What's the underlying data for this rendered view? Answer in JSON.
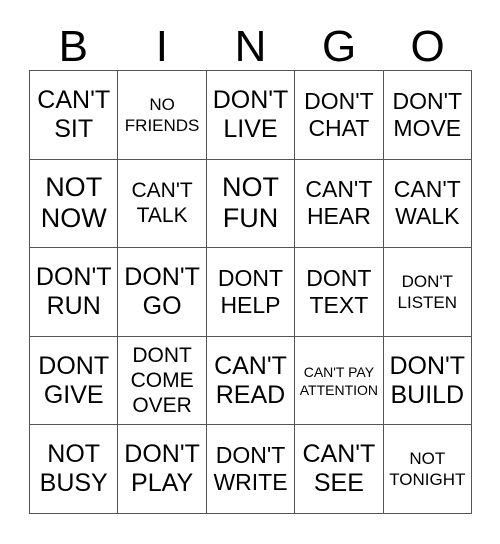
{
  "card": {
    "title_letters": [
      "B",
      "I",
      "N",
      "G",
      "O"
    ],
    "columns": 5,
    "rows": 5,
    "text_color": "#000000",
    "background_color": "#ffffff",
    "grid_line_color": "#555555"
  },
  "cells": [
    {
      "text": "CAN'T\nSIT",
      "size": "fs-lg"
    },
    {
      "text": "NO\nFRIENDS",
      "size": "fs-xs"
    },
    {
      "text": "DON'T\nLIVE",
      "size": "fs-lg"
    },
    {
      "text": "DON'T\nCHAT",
      "size": "fs-md"
    },
    {
      "text": "DON'T\nMOVE",
      "size": "fs-md"
    },
    {
      "text": "NOT\nNOW",
      "size": "fs-xl"
    },
    {
      "text": "CAN'T\nTALK",
      "size": "fs-sm"
    },
    {
      "text": "NOT\nFUN",
      "size": "fs-xl"
    },
    {
      "text": "CAN'T\nHEAR",
      "size": "fs-md"
    },
    {
      "text": "CAN'T\nWALK",
      "size": "fs-md"
    },
    {
      "text": "DON'T\nRUN",
      "size": "fs-lg"
    },
    {
      "text": "DON'T\nGO",
      "size": "fs-lg"
    },
    {
      "text": "DONT\nHELP",
      "size": "fs-md"
    },
    {
      "text": "DONT\nTEXT",
      "size": "fs-md"
    },
    {
      "text": "DON'T\nLISTEN",
      "size": "fs-xs"
    },
    {
      "text": "DONT\nGIVE",
      "size": "fs-lg"
    },
    {
      "text": "DONT\nCOME\nOVER",
      "size": "fs-sm"
    },
    {
      "text": "CAN'T\nREAD",
      "size": "fs-lg"
    },
    {
      "text": "CAN'T PAY\nATTENTION",
      "size": "fs-xxs"
    },
    {
      "text": "DON'T\nBUILD",
      "size": "fs-lg"
    },
    {
      "text": "NOT\nBUSY",
      "size": "fs-lg"
    },
    {
      "text": "DON'T\nPLAY",
      "size": "fs-lg"
    },
    {
      "text": "DON'T\nWRITE",
      "size": "fs-md"
    },
    {
      "text": "CAN'T\nSEE",
      "size": "fs-lg"
    },
    {
      "text": "NOT\nTONIGHT",
      "size": "fs-xs"
    }
  ]
}
